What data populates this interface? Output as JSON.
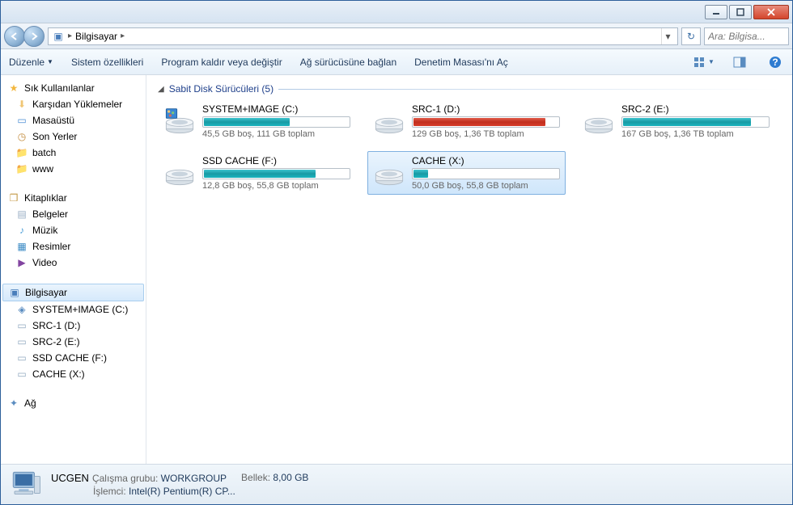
{
  "titlebar": {
    "minimize": "_",
    "maximize": "▢",
    "close": "✕"
  },
  "address": {
    "root": "Bilgisayar",
    "search_placeholder": "Ara: Bilgisa..."
  },
  "toolbar": {
    "organize": "Düzenle",
    "system_props": "Sistem özellikleri",
    "uninstall": "Program kaldır veya değiştir",
    "map_drive": "Ağ sürücüsüne bağlan",
    "control_panel": "Denetim Masası'nı Aç"
  },
  "sidebar": {
    "favorites": "Sık Kullanılanlar",
    "fav_items": [
      {
        "icon": "download",
        "label": "Karşıdan Yüklemeler"
      },
      {
        "icon": "desktop",
        "label": "Masaüstü"
      },
      {
        "icon": "recent",
        "label": "Son Yerler"
      },
      {
        "icon": "folder",
        "label": "batch"
      },
      {
        "icon": "folder",
        "label": "www"
      }
    ],
    "libraries": "Kitaplıklar",
    "lib_items": [
      {
        "icon": "doc",
        "label": "Belgeler"
      },
      {
        "icon": "music",
        "label": "Müzik"
      },
      {
        "icon": "pic",
        "label": "Resimler"
      },
      {
        "icon": "video",
        "label": "Video"
      }
    ],
    "computer": "Bilgisayar",
    "drives": [
      {
        "label": "SYSTEM+IMAGE (C:)"
      },
      {
        "label": "SRC-1 (D:)"
      },
      {
        "label": "SRC-2 (E:)"
      },
      {
        "label": "SSD CACHE (F:)"
      },
      {
        "label": "CACHE (X:)"
      }
    ],
    "network": "Ağ"
  },
  "main": {
    "section_title": "Sabit Disk Sürücüleri (5)",
    "drives": [
      {
        "name": "SYSTEM+IMAGE (C:)",
        "sub": "45,5 GB boş, 111 GB toplam",
        "pct": 59,
        "color": "teal",
        "sys": true
      },
      {
        "name": "SRC-1 (D:)",
        "sub": "129 GB boş, 1,36 TB toplam",
        "pct": 91,
        "color": "red",
        "sys": false
      },
      {
        "name": "SRC-2 (E:)",
        "sub": "167 GB boş, 1,36 TB toplam",
        "pct": 88,
        "color": "teal",
        "sys": false
      },
      {
        "name": "SSD CACHE (F:)",
        "sub": "12,8 GB boş, 55,8 GB toplam",
        "pct": 77,
        "color": "teal",
        "sys": false
      },
      {
        "name": "CACHE (X:)",
        "sub": "50,0 GB boş, 55,8 GB toplam",
        "pct": 10,
        "color": "teal",
        "sys": false,
        "selected": true
      }
    ]
  },
  "status": {
    "name": "UCGEN",
    "workgroup_lbl": "Çalışma grubu:",
    "workgroup": "WORKGROUP",
    "memory_lbl": "Bellek:",
    "memory": "8,00 GB",
    "cpu_lbl": "İşlemci:",
    "cpu": "Intel(R) Pentium(R) CP..."
  }
}
